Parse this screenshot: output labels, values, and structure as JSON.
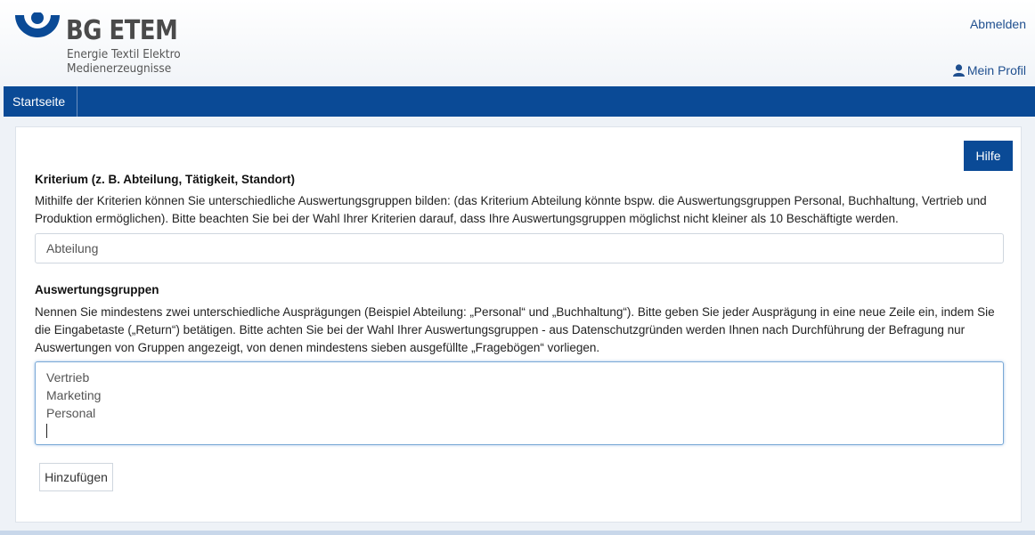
{
  "header": {
    "logo_name": "BG ETEM",
    "logo_sub_line1": "Energie Textil Elektro",
    "logo_sub_line2": "Medienerzeugnisse",
    "logout_label": "Abmelden",
    "profile_label": "Mein Profil",
    "profile_icon": "user-icon"
  },
  "nav": {
    "items": [
      {
        "label": "Startseite"
      }
    ]
  },
  "main": {
    "help_label": "Hilfe",
    "criterion": {
      "label": "Kriterium (z. B. Abteilung, Tätigkeit, Standort)",
      "description": "Mithilfe der Kriterien können Sie unterschiedliche Auswertungsgruppen bilden: (das Kriterium Abteilung könnte bspw. die Auswertungsgruppen Personal, Buchhaltung, Vertrieb und Produktion ermöglichen). Bitte beachten Sie bei der Wahl Ihrer Kriterien darauf, dass Ihre Auswertungsgruppen möglichst nicht kleiner als 10 Beschäftigte werden.",
      "value": "Abteilung"
    },
    "groups": {
      "label": "Auswertungsgruppen",
      "description": "Nennen Sie mindestens zwei unterschiedliche Ausprägungen (Beispiel Abteilung: „Personal“ und „Buchhaltung“). Bitte geben Sie jeder Ausprägung in eine neue Zeile ein, indem Sie die Eingabetaste („Return“) betätigen. Bitte achten Sie bei der Wahl Ihrer Auswertungsgruppen - aus Datenschutzgründen werden Ihnen nach Durchführung der Befragung nur Auswertungen von Gruppen angezeigt, von denen mindestens sieben ausgefüllte „Fragebögen“ vorliegen.",
      "lines": [
        "Vertrieb",
        "Marketing",
        "Personal"
      ]
    },
    "add_label": "Hinzufügen"
  },
  "colors": {
    "brand_blue": "#0a4a96",
    "link_blue": "#1f4f8f"
  }
}
